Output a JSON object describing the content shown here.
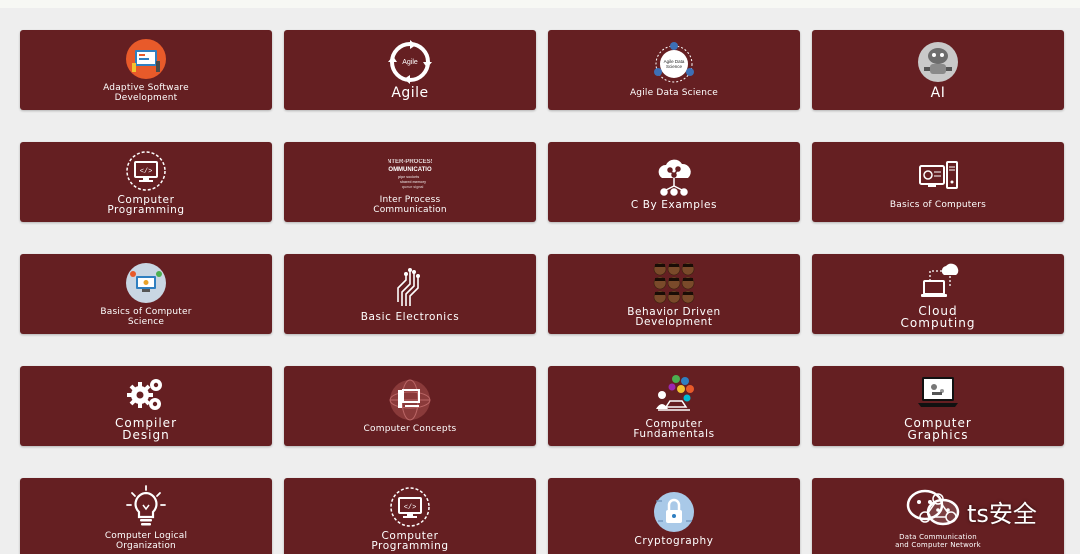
{
  "courses": [
    {
      "label": "Adaptive Software\nDevelopment",
      "icon": "tools-icon",
      "size": "small"
    },
    {
      "label": "Agile",
      "icon": "agile-cycle-icon",
      "size": "big"
    },
    {
      "label": "Agile Data Science",
      "icon": "agile-data-science-icon",
      "size": "small"
    },
    {
      "label": "AI",
      "icon": "robot-icon",
      "size": "big"
    },
    {
      "label": "Computer\nProgramming",
      "icon": "monitor-code-icon",
      "size": "med"
    },
    {
      "label": "Inter Process\nCommunication",
      "icon": "word-cloud-icon",
      "size": "small"
    },
    {
      "label": "C By Examples",
      "icon": "cloud-network-icon",
      "size": "med"
    },
    {
      "label": "Basics of Computers",
      "icon": "computer-icon",
      "size": "small"
    },
    {
      "label": "Basics of Computer\nScience",
      "icon": "computer-science-icon",
      "size": "small"
    },
    {
      "label": "Basic Electronics",
      "icon": "circuit-icon",
      "size": "med"
    },
    {
      "label": "Behavior Driven\nDevelopment",
      "icon": "faces-icon",
      "size": "med"
    },
    {
      "label": "Cloud\nComputing",
      "icon": "cloud-computing-icon",
      "size": "big-med"
    },
    {
      "label": "Compiler\nDesign",
      "icon": "gears-icon",
      "size": "big-med"
    },
    {
      "label": "Computer Concepts",
      "icon": "globe-computer-icon",
      "size": "small"
    },
    {
      "label": "Computer\nFundamentals",
      "icon": "person-laptop-icon",
      "size": "med"
    },
    {
      "label": "Computer\nGraphics",
      "icon": "laptop-graphics-icon",
      "size": "big-med"
    },
    {
      "label": "Computer Logical\nOrganization",
      "icon": "lightbulb-icon",
      "size": "small"
    },
    {
      "label": "Computer\nProgramming",
      "icon": "monitor-code-icon",
      "size": "med"
    },
    {
      "label": "Cryptography",
      "icon": "lock-icon",
      "size": "med"
    },
    {
      "label": "Data Communication\nand Computer Network",
      "icon": "network-icon",
      "size": "xs"
    }
  ],
  "watermark": {
    "text": "ts安全",
    "icon": "wechat-icon"
  },
  "colors": {
    "card": "#651f22",
    "background": "#eeeeee"
  }
}
